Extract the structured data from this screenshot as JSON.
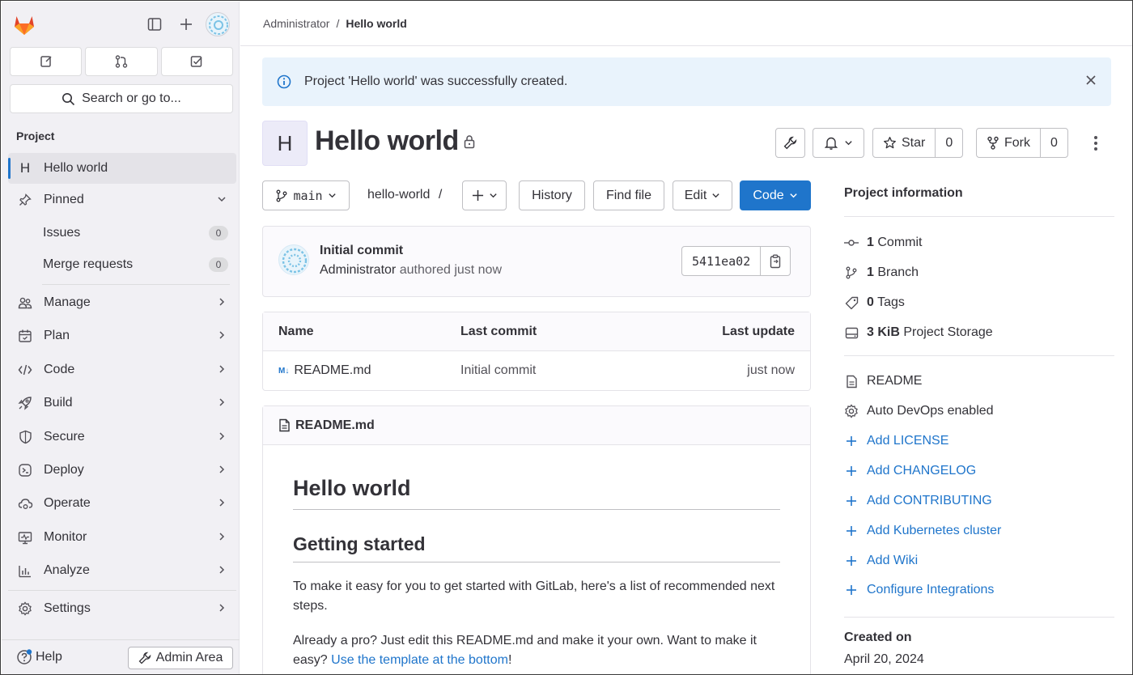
{
  "sidebar": {
    "search_placeholder": "Search or go to...",
    "section_title": "Project",
    "project_initial": "H",
    "project_name": "Hello world",
    "pinned": "Pinned",
    "issues": {
      "label": "Issues",
      "count": "0"
    },
    "merge_requests": {
      "label": "Merge requests",
      "count": "0"
    },
    "items": [
      {
        "label": "Manage",
        "icon": "users-icon"
      },
      {
        "label": "Plan",
        "icon": "calendar-icon"
      },
      {
        "label": "Code",
        "icon": "code-icon"
      },
      {
        "label": "Build",
        "icon": "rocket-icon"
      },
      {
        "label": "Secure",
        "icon": "shield-icon"
      },
      {
        "label": "Deploy",
        "icon": "deploy-icon"
      },
      {
        "label": "Operate",
        "icon": "cloud-icon"
      },
      {
        "label": "Monitor",
        "icon": "monitor-icon"
      },
      {
        "label": "Analyze",
        "icon": "chart-icon"
      }
    ],
    "settings": "Settings",
    "help": "Help",
    "admin_area": "Admin Area"
  },
  "breadcrumb": {
    "parent": "Administrator",
    "separator": "/",
    "current": "Hello world"
  },
  "alert": {
    "message": "Project 'Hello world' was successfully created."
  },
  "project": {
    "initial": "H",
    "title": "Hello world",
    "star_label": "Star",
    "star_count": "0",
    "fork_label": "Fork",
    "fork_count": "0"
  },
  "toolbar": {
    "branch": "main",
    "path": "hello-world",
    "path_sep": "/",
    "history": "History",
    "find_file": "Find file",
    "edit": "Edit",
    "code": "Code"
  },
  "commit": {
    "title": "Initial commit",
    "author": "Administrator",
    "meta": "authored just now",
    "sha": "5411ea02"
  },
  "files": {
    "headers": {
      "name": "Name",
      "last_commit": "Last commit",
      "last_update": "Last update"
    },
    "rows": [
      {
        "name": "README.md",
        "last_commit": "Initial commit",
        "last_update": "just now"
      }
    ]
  },
  "readme": {
    "filename": "README.md",
    "h1": "Hello world",
    "h2": "Getting started",
    "p1": "To make it easy for you to get started with GitLab, here's a list of recommended next steps.",
    "p2_before": "Already a pro? Just edit this README.md and make it your own. Want to make it easy? ",
    "p2_link": "Use the template at the bottom",
    "p2_after": "!"
  },
  "project_info": {
    "title": "Project information",
    "commits": {
      "count": "1",
      "label": "Commit"
    },
    "branches": {
      "count": "1",
      "label": "Branch"
    },
    "tags": {
      "count": "0",
      "label": "Tags"
    },
    "storage": {
      "count": "3 KiB",
      "label": "Project Storage"
    },
    "readme": "README",
    "auto_devops": "Auto DevOps enabled",
    "links": [
      "Add LICENSE",
      "Add CHANGELOG",
      "Add CONTRIBUTING",
      "Add Kubernetes cluster",
      "Add Wiki",
      "Configure Integrations"
    ],
    "created_label": "Created on",
    "created_value": "April 20, 2024"
  },
  "colors": {
    "accent": "#1f75cb",
    "sidebar_bg": "#f1f0f4",
    "alert_bg": "#e9f3fc",
    "logo_orange": "#e24329"
  }
}
